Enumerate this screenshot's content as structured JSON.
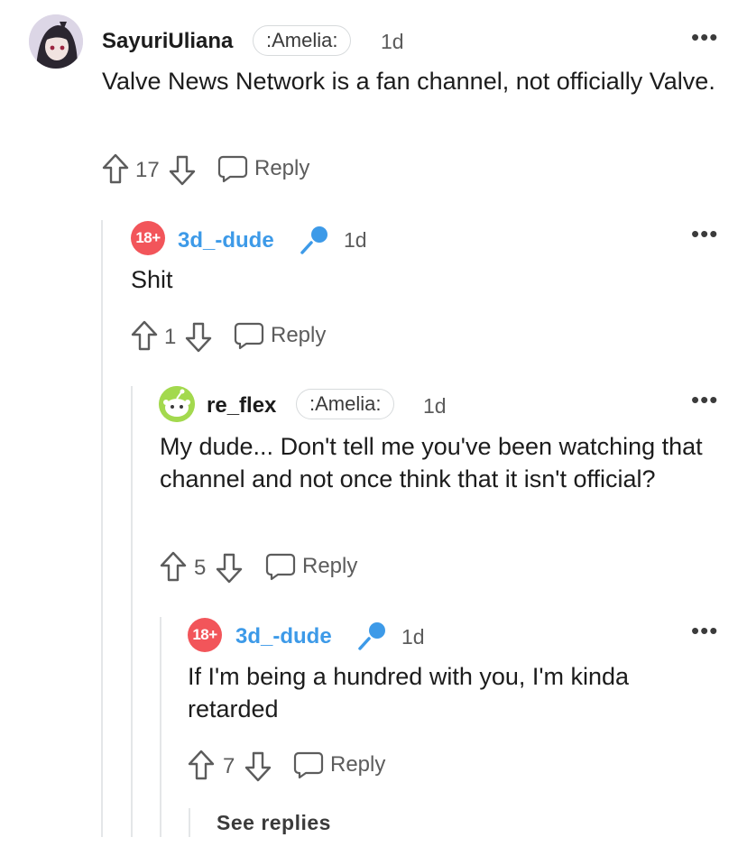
{
  "comments": [
    {
      "user": "SayuriUliana",
      "flair": ":Amelia:",
      "time": "1d",
      "body": "Valve News Network is a fan channel, not officially Valve.",
      "score": "17",
      "reply_label": "Reply",
      "more": "•••"
    },
    {
      "user": "3d_-dude",
      "badge": "18+",
      "time": "1d",
      "body": "Shit",
      "score": "1",
      "reply_label": "Reply",
      "more": "•••"
    },
    {
      "user": "re_flex",
      "flair": ":Amelia:",
      "time": "1d",
      "body": "My dude... Don't tell me you've been watching that channel and not once think that it isn't official?",
      "score": "5",
      "reply_label": "Reply",
      "more": "•••"
    },
    {
      "user": "3d_-dude",
      "badge": "18+",
      "time": "1d",
      "body": "If I'm being a hundred with you, I'm kinda retarded",
      "score": "7",
      "reply_label": "Reply",
      "more": "•••"
    }
  ],
  "see_replies": "See replies",
  "colors": {
    "mod_blue": "#3d9ae8",
    "nsfw_badge": "#f2555a",
    "thread_line": "#e4e6e8"
  },
  "icons": [
    "upvote-icon",
    "downvote-icon",
    "reply-bubble-icon",
    "microphone-icon",
    "more-options-icon"
  ]
}
